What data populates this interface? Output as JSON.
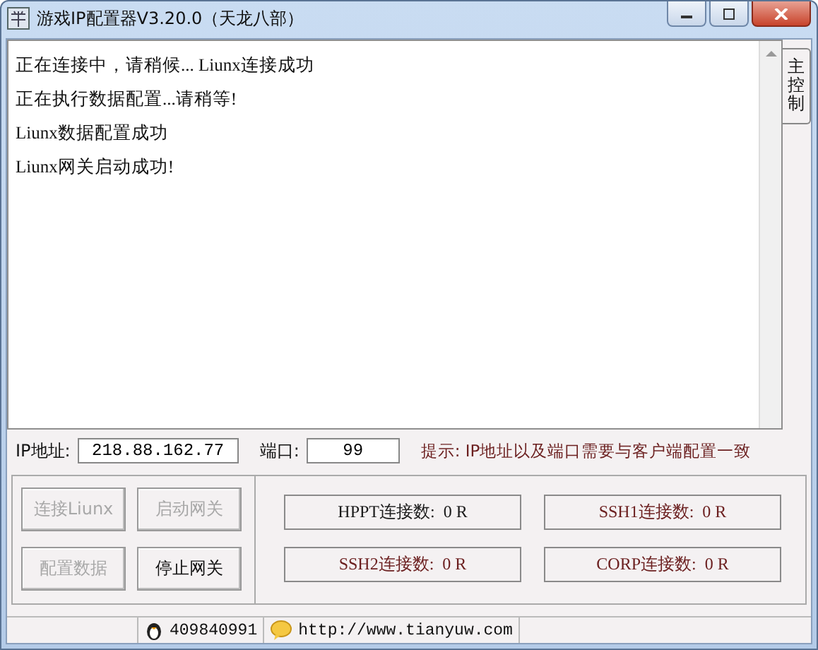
{
  "window": {
    "title": "游戏IP配置器V3.20.0（天龙八部）"
  },
  "log": {
    "lines": [
      "正在连接中，请稍候... Liunx连接成功",
      "正在执行数据配置...请稍等!",
      "Liunx数据配置成功",
      "Liunx网关启动成功!"
    ]
  },
  "side_tab": {
    "label": "主控制",
    "selected": true
  },
  "connection": {
    "ip_label": "IP地址:",
    "ip_value": "218.88.162.77",
    "port_label": "端口:",
    "port_value": "99",
    "hint": "提示: IP地址以及端口需要与客户端配置一致"
  },
  "buttons": [
    {
      "label": "连接Liunx",
      "disabled": true
    },
    {
      "label": "启动网关",
      "disabled": true
    },
    {
      "label": "配置数据",
      "disabled": true
    },
    {
      "label": "停止网关",
      "disabled": false
    }
  ],
  "counters": [
    {
      "label": "HPPT连接数:  0 R",
      "color": "#1a1a1a"
    },
    {
      "label": "SSH1连接数:  0 R",
      "color": "#6b1f1f"
    },
    {
      "label": "SSH2连接数:  0 R",
      "color": "#6b1f1f"
    },
    {
      "label": "CORP连接数:  0 R",
      "color": "#6b1f1f"
    }
  ],
  "status_bar": {
    "qq": "409840991",
    "url": "http://www.tianyuw.com"
  }
}
